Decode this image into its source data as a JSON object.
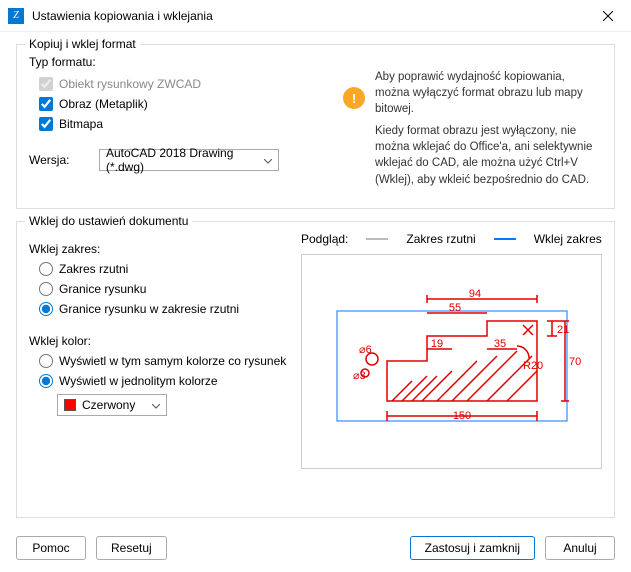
{
  "window": {
    "title": "Ustawienia kopiowania i wklejania"
  },
  "group1": {
    "title": "Kopiuj i wklej format",
    "formatLabel": "Typ formatu:",
    "opt1": "Obiekt rysunkowy ZWCAD",
    "opt2": "Obraz (Metaplik)",
    "opt3": "Bitmapa",
    "versionLabel": "Wersja:",
    "versionValue": "AutoCAD 2018 Drawing (*.dwg)",
    "info1": "Aby poprawić wydajność kopiowania, można wyłączyć format obrazu lub mapy bitowej.",
    "info2": "Kiedy format obrazu jest wyłączony, nie można wklejać do Office'a, ani selektywnie wklejać do CAD, ale można użyć Ctrl+V (Wklej), aby wkleić bezpośrednio do CAD."
  },
  "group2": {
    "title": "Wklej do ustawień dokumentu",
    "rangeLabel": "Wklej zakres:",
    "r1": "Zakres rzutni",
    "r2": "Granice rysunku",
    "r3": "Granice rysunku w zakresie rzutni",
    "colorLabel": "Wklej kolor:",
    "c1": "Wyświetl w tym samym kolorze co rysunek",
    "c2": "Wyświetl w jednolitym kolorze",
    "colorValue": "Czerwony",
    "previewLabel": "Podgląd:",
    "legend1": "Zakres rzutni",
    "legend2": "Wklej zakres"
  },
  "buttons": {
    "help": "Pomoc",
    "reset": "Resetuj",
    "applyClose": "Zastosuj i zamknij",
    "cancel": "Anuluj"
  }
}
